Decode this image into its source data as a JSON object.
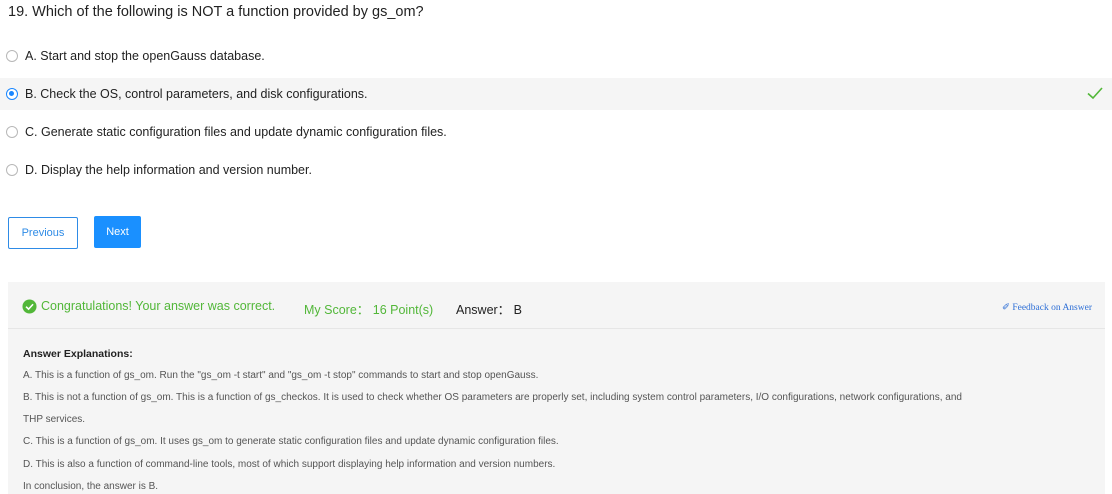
{
  "question": {
    "title": "19. Which of the following is NOT a function provided by gs_om?"
  },
  "options": [
    {
      "label": "A. Start and stop the openGauss database."
    },
    {
      "label": "B. Check the OS, control parameters, and disk configurations."
    },
    {
      "label": "C. Generate static configuration files and update dynamic configuration files."
    },
    {
      "label": "D. Display the help information and version number."
    }
  ],
  "selected_option": "B",
  "buttons": {
    "previous": "Previous",
    "next": "Next"
  },
  "result": {
    "message": "Congratulations! Your answer was correct.",
    "score": "My Score： 16 Point(s)",
    "answer": "Answer： B",
    "feedback": "✐ Feedback on Answer",
    "explanation_title": "Answer Explanations:",
    "explanation_lines": [
      "A. This is a function of gs_om. Run the \"gs_om -t start\" and \"gs_om -t stop\" commands to start and stop openGauss.",
      "B. This is not a function of gs_om. This is a function of gs_checkos. It is used to check whether OS parameters are properly set, including system control parameters, I/O configurations, network configurations, and",
      "THP services.",
      "C. This is a function of gs_om. It uses gs_om to generate static configuration files and update dynamic configuration files.",
      "D. This is also a function of command-line tools, most of which support displaying help information and version numbers.",
      "In conclusion, the answer is B."
    ]
  },
  "colors": {
    "accent": "#1a90ff",
    "success": "#52b739",
    "panel_bg": "#f5f5f5"
  }
}
